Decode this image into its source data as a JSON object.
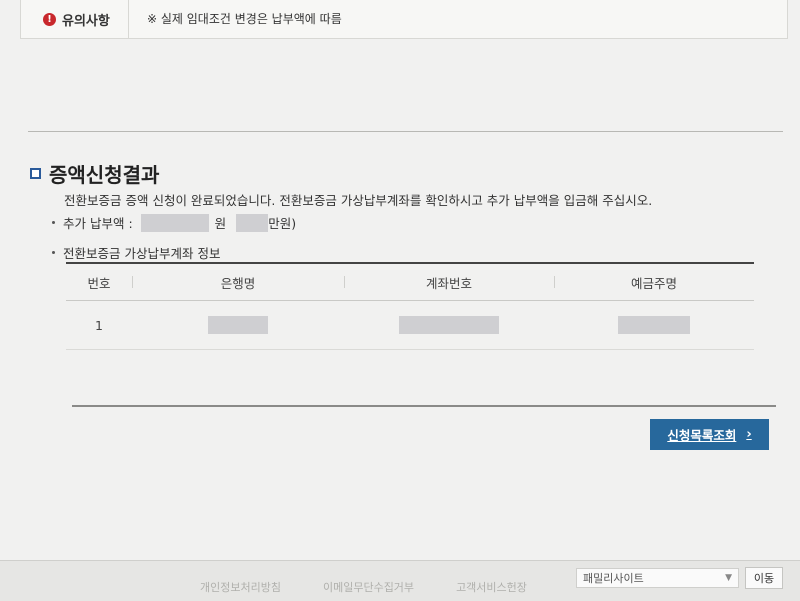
{
  "notice": {
    "heading": "유의사항",
    "text": "※ 실제 임대조건 변경은 납부액에 따름"
  },
  "result": {
    "title": "증액신청결과",
    "message": "전환보증금 증액 신청이 완료되었습니다. 전환보증금 가상납부계좌를 확인하시고 추가 납부액을 입금해 주십시오.",
    "additional_label": "추가 납부액 :",
    "won_unit": "원",
    "manwon_unit": "만원)",
    "account_info_label": "전환보증금 가상납부계좌 정보"
  },
  "table": {
    "headers": [
      "번호",
      "은행명",
      "계좌번호",
      "예금주명"
    ],
    "rows": [
      {
        "no": "1"
      }
    ]
  },
  "list_button": {
    "label": "신청목록조회",
    "chevron": "›"
  },
  "footer": {
    "links": [
      "개인정보처리방침",
      "이메일무단수집거부",
      "고객서비스헌장"
    ],
    "family_site": "패밀리사이트",
    "go_label": "이동"
  }
}
